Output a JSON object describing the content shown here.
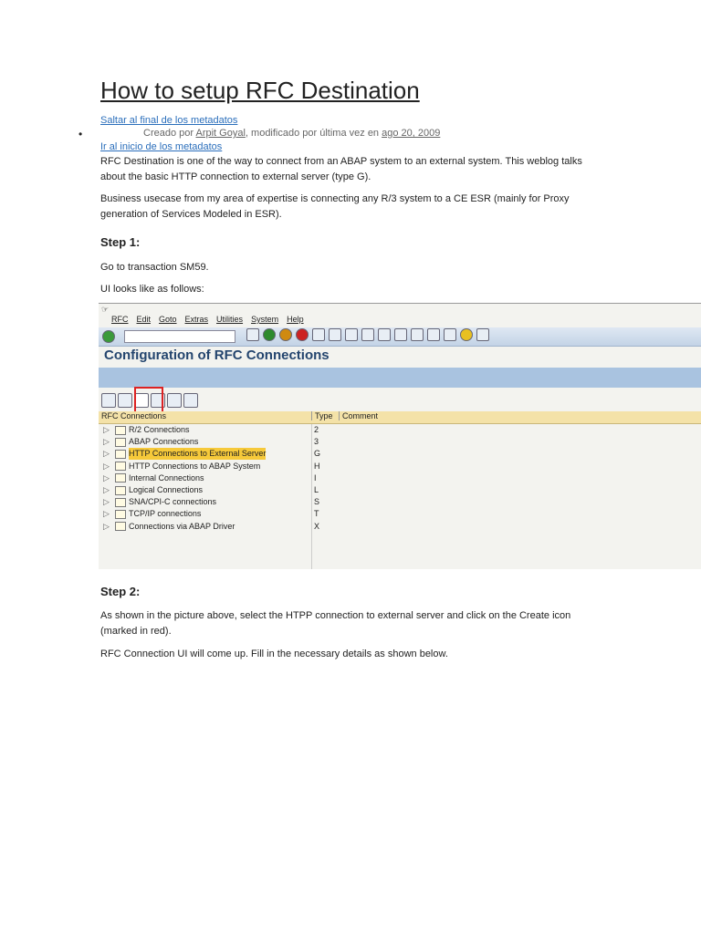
{
  "title": "How to setup RFC Destination",
  "meta": {
    "skip_end": "Saltar al final de los metadatos",
    "created_by_prefix": "Creado por",
    "author": "Arpit Goyal",
    "modified_text": ", modificado por última vez en",
    "date": "ago 20, 2009",
    "go_start": "Ir al inicio de los metadatos"
  },
  "paras": [
    "RFC Destination is one of the way to connect from an ABAP system to an external system. This weblog talks about the basic HTTP connection to external server (type G).",
    "Business usecase from my area of expertise is connecting any R/3 system to a CE ESR (mainly for Proxy generation of Services Modeled in ESR)."
  ],
  "step1": {
    "heading": "Step 1:",
    "p1": "Go to transaction SM59.",
    "p2": "UI looks like as follows:"
  },
  "sap": {
    "menu": [
      "RFC",
      "Edit",
      "Goto",
      "Extras",
      "Utilities",
      "System",
      "Help"
    ],
    "title": "Configuration of RFC Connections",
    "col_conn": "RFC Connections",
    "col_type": "Type",
    "col_comment": "Comment",
    "rows": [
      {
        "name": "R/2 Connections",
        "type": "2"
      },
      {
        "name": "ABAP Connections",
        "type": "3"
      },
      {
        "name": "HTTP Connections to External Server",
        "type": "G"
      },
      {
        "name": "HTTP Connections to ABAP System",
        "type": "H"
      },
      {
        "name": "Internal Connections",
        "type": "I"
      },
      {
        "name": "Logical Connections",
        "type": "L"
      },
      {
        "name": "SNA/CPI-C connections",
        "type": "S"
      },
      {
        "name": "TCP/IP connections",
        "type": "T"
      },
      {
        "name": "Connections via ABAP Driver",
        "type": "X"
      }
    ]
  },
  "step2": {
    "heading": "Step 2:",
    "p1": "As shown in the picture above, select the HTPP connection to external server and click on the Create icon (marked in red).",
    "p2": "RFC Connection UI will come up. Fill in the necessary details as shown below."
  }
}
